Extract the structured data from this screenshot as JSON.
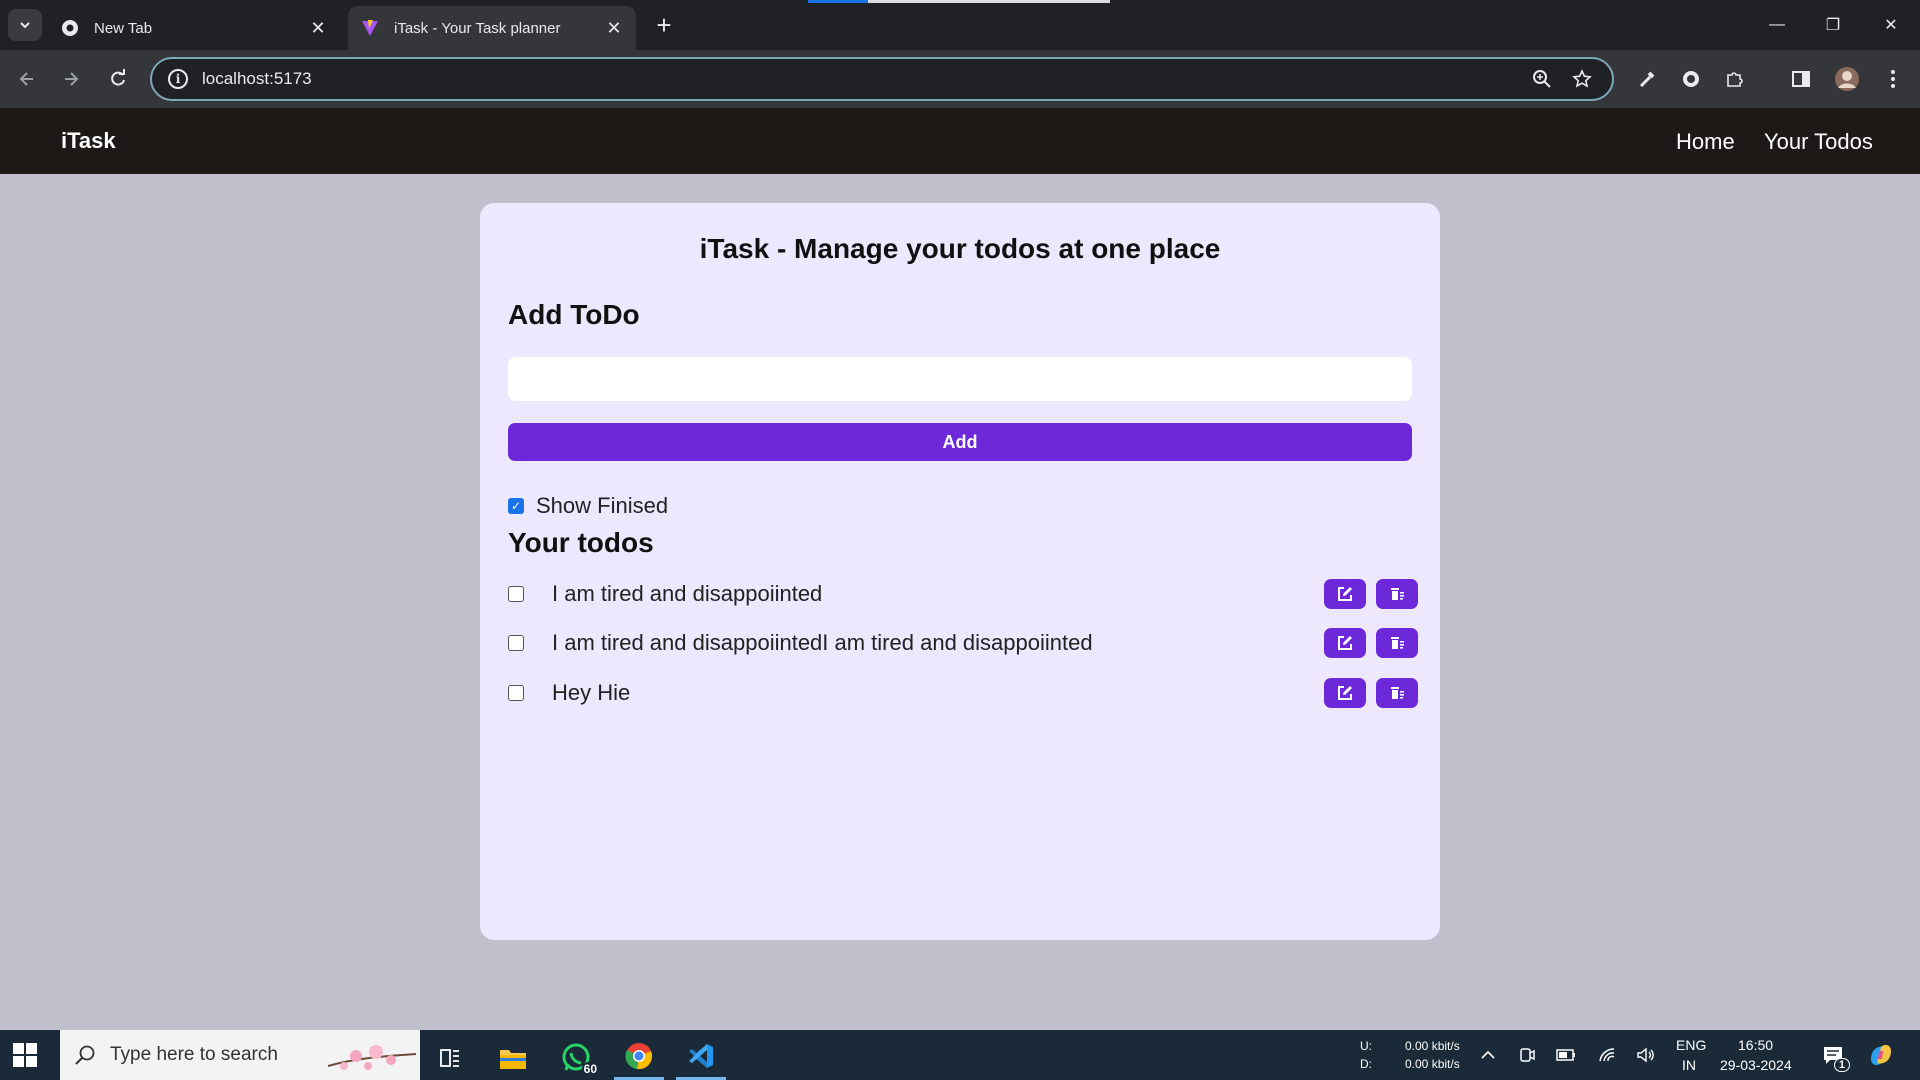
{
  "browser": {
    "tabs": [
      {
        "title": "New Tab",
        "active": false
      },
      {
        "title": "iTask - Your Task planner",
        "active": true
      }
    ],
    "url": "localhost:5173"
  },
  "site": {
    "brand": "iTask",
    "nav": [
      "Home",
      "Your Todos"
    ]
  },
  "card": {
    "title": "iTask - Manage your todos at one place",
    "add_heading": "Add ToDo",
    "input_value": "",
    "add_button": "Add",
    "show_finished_label": "Show Finised",
    "show_finished_checked": true,
    "todos_heading": "Your todos",
    "todos": [
      {
        "text": "I am tired and disappoiinted",
        "done": false
      },
      {
        "text": "I am tired and disappoiintedI am tired and disappoiinted",
        "done": false
      },
      {
        "text": "Hey Hie",
        "done": false
      }
    ]
  },
  "taskbar": {
    "search_placeholder": "Type here to search",
    "whatsapp_badge": "60",
    "net_upload_label": "U:",
    "net_download_label": "D:",
    "net_upload": "0.00 kbit/s",
    "net_download": "0.00 kbit/s",
    "language": "ENG",
    "region": "IN",
    "time": "16:50",
    "date": "29-03-2024",
    "notification_count": "1"
  },
  "colors": {
    "accent": "#6d28d9",
    "nav_bg": "#1c1917",
    "card_bg": "#ede8fd",
    "page_bg": "#c0bfcc"
  }
}
